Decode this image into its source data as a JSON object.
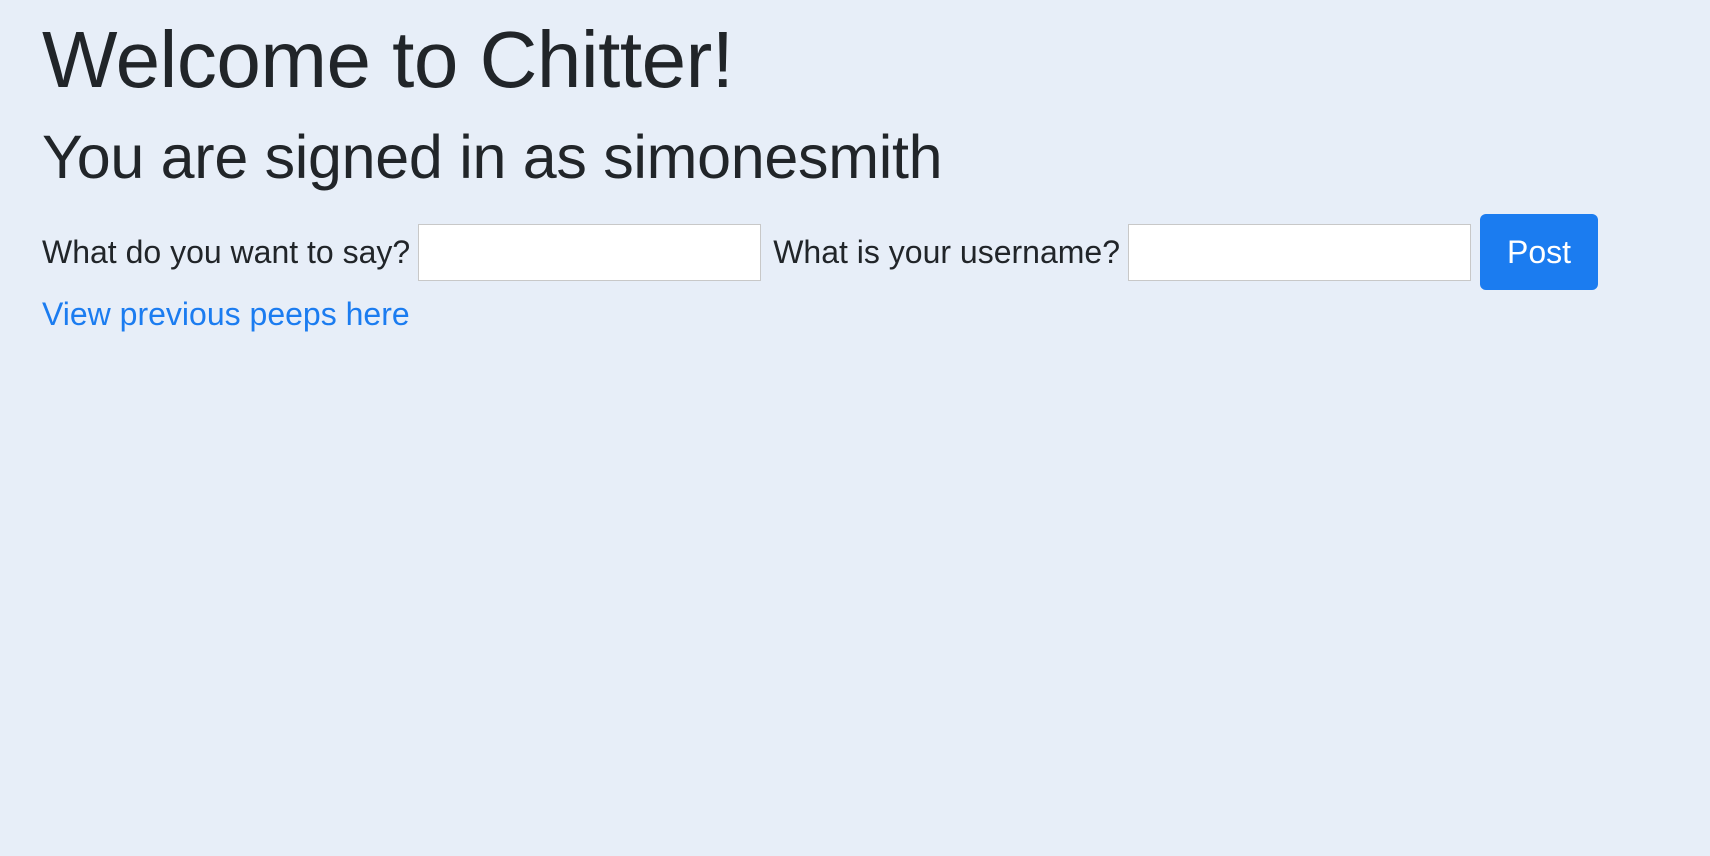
{
  "page": {
    "title": "Welcome to Chitter!",
    "signed_in_text": "You are signed in as simonesmith"
  },
  "post_form": {
    "message_label": "What do you want to say?",
    "message_value": "",
    "username_label": "What is your username?",
    "username_value": "",
    "post_button_label": "Post"
  },
  "links": {
    "previous_peeps": "View previous peeps here"
  },
  "colors": {
    "background": "#e7eef8",
    "text": "#212529",
    "accent": "#1b7cf0",
    "button_text": "#ffffff"
  }
}
